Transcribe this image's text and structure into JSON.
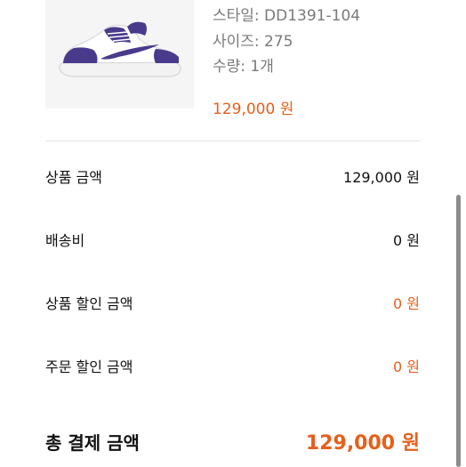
{
  "product": {
    "image_icon": "sneaker-image",
    "style_line": "스타일: DD1391-104",
    "size_line": "사이즈: 275",
    "quantity_line": "수량: 1개",
    "price": "129,000 원"
  },
  "summary": {
    "subtotal": {
      "label": "상품 금액",
      "value": "129,000 원"
    },
    "shipping": {
      "label": "배송비",
      "value": "0 원"
    },
    "product_discount": {
      "label": "상품 할인 금액",
      "value": "0 원"
    },
    "order_discount": {
      "label": "주문 할인 금액",
      "value": "0 원"
    },
    "total": {
      "label": "총 결제 금액",
      "value": "129,000 원"
    }
  },
  "colors": {
    "accent": "#e5601c",
    "muted_text": "#7a7a7a",
    "sneaker_purple": "#4a3a8c"
  }
}
